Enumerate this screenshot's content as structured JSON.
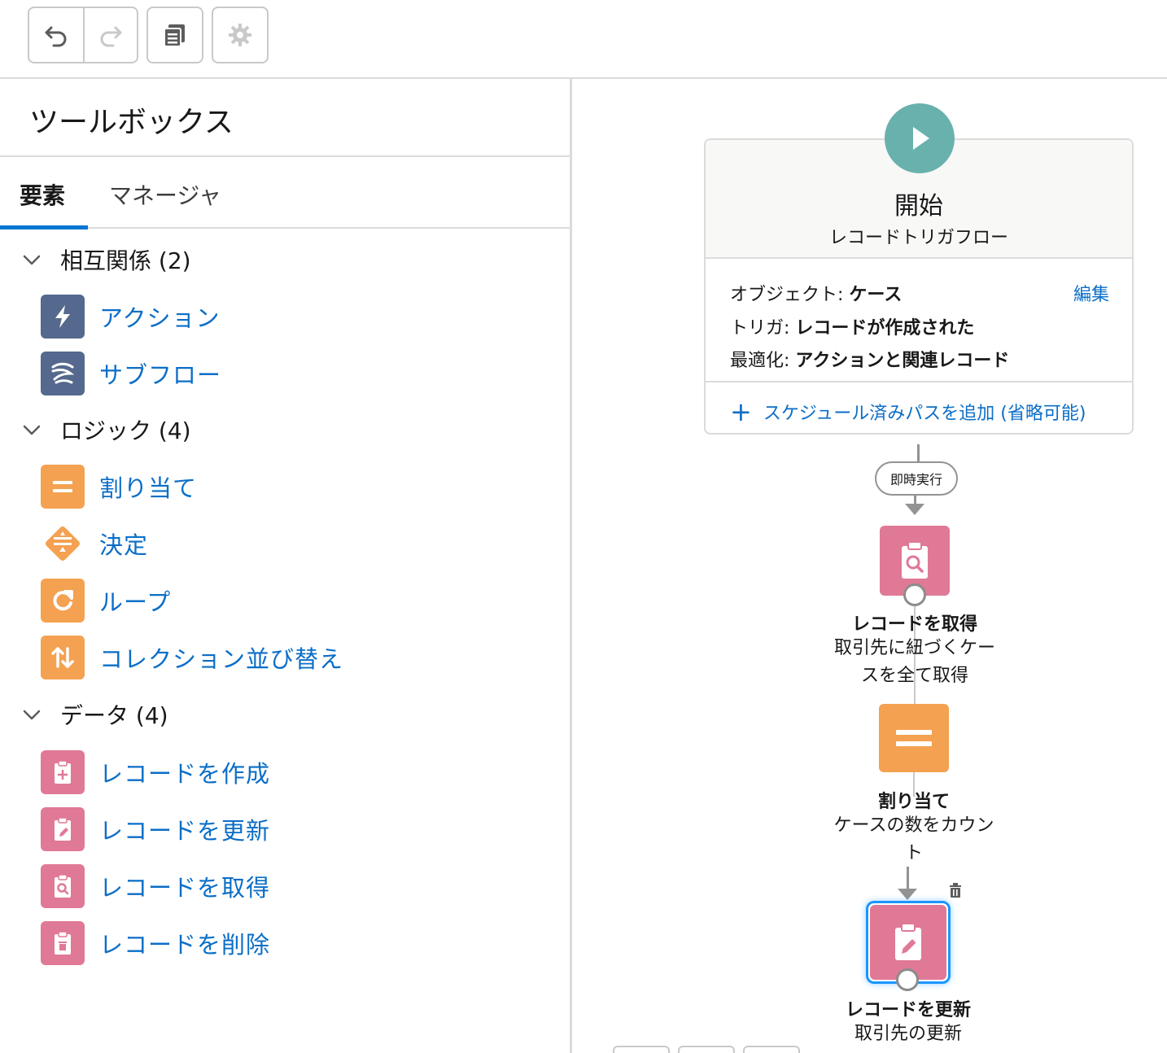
{
  "toolbar": {
    "undo_icon": "undo-icon",
    "redo_icon": "redo-icon",
    "copy_icon": "copy-icon",
    "settings_icon": "gear-icon"
  },
  "toolbox": {
    "title": "ツールボックス",
    "tabs": [
      {
        "label": "要素",
        "active": true
      },
      {
        "label": "マネージャ",
        "active": false
      }
    ],
    "sections": [
      {
        "label": "相互関係 (2)",
        "items": [
          {
            "label": "アクション",
            "icon": "lightning-icon",
            "color": "#54698d"
          },
          {
            "label": "サブフロー",
            "icon": "subflow-icon",
            "color": "#54698d"
          }
        ]
      },
      {
        "label": "ロジック (4)",
        "items": [
          {
            "label": "割り当て",
            "icon": "assignment-icon",
            "color": "#f4a151"
          },
          {
            "label": "決定",
            "icon": "decision-icon",
            "color": "#f4a151"
          },
          {
            "label": "ループ",
            "icon": "loop-icon",
            "color": "#f4a151"
          },
          {
            "label": "コレクション並び替え",
            "icon": "sort-icon",
            "color": "#f4a151"
          }
        ]
      },
      {
        "label": "データ (4)",
        "items": [
          {
            "label": "レコードを作成",
            "icon": "record-create-icon",
            "color": "#e07996"
          },
          {
            "label": "レコードを更新",
            "icon": "record-update-icon",
            "color": "#e07996"
          },
          {
            "label": "レコードを取得",
            "icon": "record-lookup-icon",
            "color": "#e07996"
          },
          {
            "label": "レコードを削除",
            "icon": "record-delete-icon",
            "color": "#e07996"
          }
        ]
      }
    ]
  },
  "canvas": {
    "start": {
      "title": "開始",
      "subtitle": "レコードトリガフロー",
      "object_label": "オブジェクト:",
      "object_value": "ケース",
      "trigger_label": "トリガ:",
      "trigger_value": "レコードが作成された",
      "optimize_label": "最適化:",
      "optimize_value": "アクションと関連レコード",
      "edit_link": "編集",
      "add_path": "スケジュール済みパスを追加 (省略可能)"
    },
    "connector_label": "即時実行",
    "nodes": [
      {
        "title": "レコードを取得",
        "desc_line1": "取引先に紐づくケー",
        "desc_line2": "スを全て取得",
        "icon": "record-lookup-icon",
        "color": "#e07996"
      },
      {
        "title": "割り当て",
        "desc_line1": "ケースの数をカウン",
        "desc_line2": "ト",
        "icon": "assignment-icon",
        "color": "#f4a151"
      },
      {
        "title": "レコードを更新",
        "desc_line1": "取引先の更新",
        "icon": "record-update-icon",
        "color": "#e07996",
        "selected": true
      }
    ]
  },
  "colors": {
    "link": "#0b6ec7",
    "accent": "#0176d3",
    "start_icon": "#69b1ad",
    "connector": "#939393"
  }
}
